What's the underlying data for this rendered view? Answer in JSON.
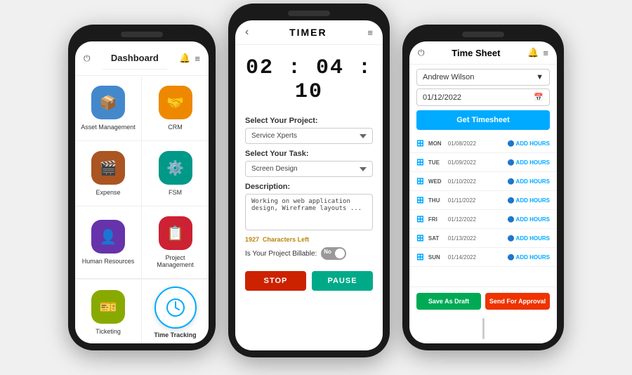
{
  "phone1": {
    "header": {
      "title": "Dashboard",
      "power_icon": "⏻",
      "bell_icon": "🔔",
      "menu_icon": "≡"
    },
    "grid": [
      {
        "label": "Asset Management",
        "color": "#4488cc",
        "icon": "📦"
      },
      {
        "label": "CRM",
        "color": "#ee8800",
        "icon": "🤝"
      },
      {
        "label": "Expense",
        "color": "#aa5522",
        "icon": "🎬"
      },
      {
        "label": "FSM",
        "color": "#009988",
        "icon": "⚙️"
      },
      {
        "label": "Human Resources",
        "color": "#6633aa",
        "icon": "👤"
      },
      {
        "label": "Project Management",
        "color": "#cc2233",
        "icon": "📋"
      }
    ],
    "bottom": [
      {
        "label": "Ticketing",
        "color": "#88aa00",
        "icon": "🎫"
      },
      {
        "label": "Time Tracking",
        "is_highlight": true
      }
    ]
  },
  "phone2": {
    "header": {
      "title": "TIMER",
      "back_label": "‹",
      "menu_icon": "≡"
    },
    "timer": "02 : 04 : 10",
    "project_label": "Select Your Project:",
    "project_value": "Service Xperts",
    "task_label": "Select Your Task:",
    "task_value": "Screen Design",
    "desc_label": "Description:",
    "desc_value": "Working on web application design, Wireframe layouts ...",
    "chars_left": "1927",
    "chars_left_label": "Characters Left",
    "billable_label": "Is Your Project Billable:",
    "toggle_state": "No",
    "stop_label": "STOP",
    "pause_label": "PAUSE"
  },
  "phone3": {
    "header": {
      "title": "Time Sheet",
      "power_icon": "⏻",
      "bell_icon": "🔔",
      "menu_icon": "≡"
    },
    "user": "Andrew Wilson",
    "date": "01/12/2022",
    "get_timesheet_label": "Get Timesheet",
    "rows": [
      {
        "day": "MON",
        "date": "01/08/2022",
        "action": "ADD HOURS"
      },
      {
        "day": "TUE",
        "date": "01/09/2022",
        "action": "ADD HOURS"
      },
      {
        "day": "WED",
        "date": "01/10/2022",
        "action": "ADD HOURS"
      },
      {
        "day": "THU",
        "date": "01/11/2022",
        "action": "ADD HOURS"
      },
      {
        "day": "FRI",
        "date": "01/12/2022",
        "action": "ADD HOURS"
      },
      {
        "day": "SAT",
        "date": "01/13/2022",
        "action": "ADD HOURS"
      },
      {
        "day": "SUN",
        "date": "01/14/2022",
        "action": "ADD HOURS"
      }
    ],
    "save_draft_label": "Save As Draft",
    "send_approval_label": "Send For Approval"
  }
}
